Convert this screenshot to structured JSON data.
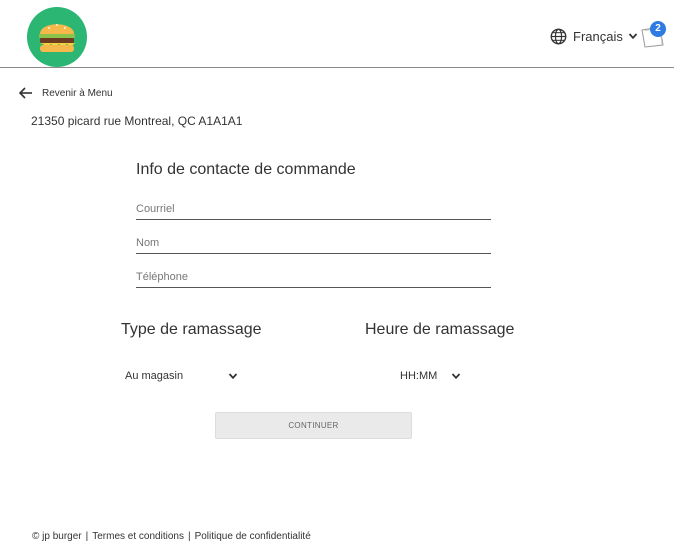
{
  "header": {
    "logo_icon": "burger-logo",
    "language": "Français",
    "cart_count": "2"
  },
  "nav": {
    "back_label": "Revenir à Menu"
  },
  "address": "21350 picard rue Montreal, QC A1A1A1",
  "form": {
    "title": "Info de contacte de commande",
    "email_placeholder": "Courriel",
    "name_placeholder": "Nom",
    "phone_placeholder": "Téléphone"
  },
  "pickup": {
    "type_title": "Type de ramassage",
    "type_value": "Au magasin",
    "time_title": "Heure de ramassage",
    "time_value": "HH:MM"
  },
  "continue_label": "CONTINUER",
  "footer": {
    "copyright": "© jp burger",
    "sep1": "|",
    "terms": "Termes et conditions",
    "sep2": "|",
    "privacy": "Politique de confidentialité"
  },
  "colors": {
    "logo_bg": "#2bb673",
    "badge": "#2e7be4",
    "button_bg": "#eaeaea"
  }
}
